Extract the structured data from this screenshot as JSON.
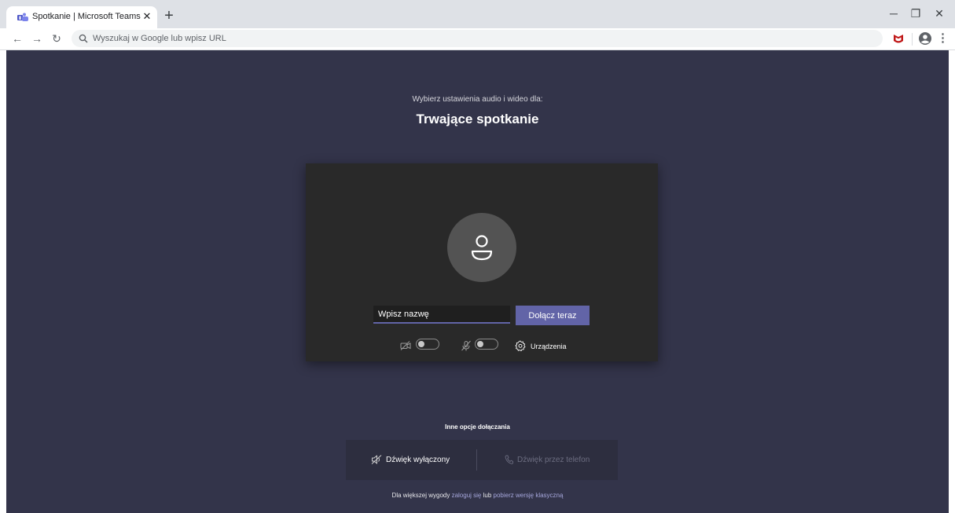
{
  "browser": {
    "tab_title": "Spotkanie | Microsoft Teams",
    "omnibox_placeholder": "Wyszukaj w Google lub wpisz URL"
  },
  "prejoin": {
    "choose_label": "Wybierz ustawienia audio i wideo dla:",
    "meeting_title": "Trwające spotkanie",
    "name_placeholder": "Wpisz nazwę",
    "join_label": "Dołącz teraz",
    "devices_label": "Urządzenia",
    "camera_on": false,
    "mic_on": false
  },
  "other_options": {
    "heading": "Inne opcje dołączania",
    "audio_off_label": "Dźwięk wyłączony",
    "phone_audio_label": "Dźwięk przez telefon"
  },
  "footer": {
    "prefix": "Dla większej wygody ",
    "signin_link": "zaloguj się",
    "middle": " lub ",
    "download_link": "pobierz wersję klasyczną"
  },
  "colors": {
    "page_bg": "#33344a",
    "card_bg": "#292929",
    "accent": "#6264a7",
    "link": "#a6a7dc"
  }
}
